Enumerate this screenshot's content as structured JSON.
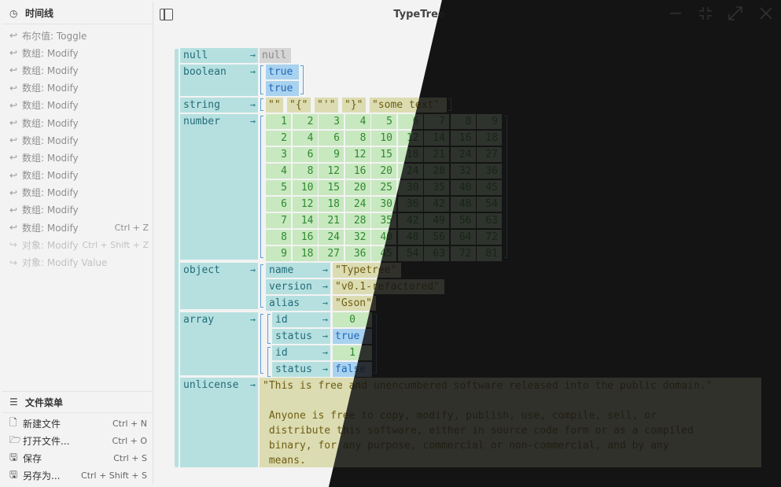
{
  "app": {
    "title": "TypeTree"
  },
  "history": {
    "header": "时间线",
    "items": [
      {
        "label": "布尔值: Toggle",
        "shortcut": "",
        "undone": false
      },
      {
        "label": "数组: Modify",
        "shortcut": "",
        "undone": false
      },
      {
        "label": "数组: Modify",
        "shortcut": "",
        "undone": false
      },
      {
        "label": "数组: Modify",
        "shortcut": "",
        "undone": false
      },
      {
        "label": "数组: Modify",
        "shortcut": "",
        "undone": false
      },
      {
        "label": "数组: Modify",
        "shortcut": "",
        "undone": false
      },
      {
        "label": "数组: Modify",
        "shortcut": "",
        "undone": false
      },
      {
        "label": "数组: Modify",
        "shortcut": "",
        "undone": false
      },
      {
        "label": "数组: Modify",
        "shortcut": "",
        "undone": false
      },
      {
        "label": "数组: Modify",
        "shortcut": "",
        "undone": false
      },
      {
        "label": "数组: Modify",
        "shortcut": "",
        "undone": false
      },
      {
        "label": "数组: Modify",
        "shortcut": "Ctrl + Z",
        "undone": false
      },
      {
        "label": "对象: Modify",
        "shortcut": "Ctrl + Shift + Z",
        "undone": true
      },
      {
        "label": "对象: Modify Value",
        "shortcut": "",
        "undone": true
      }
    ]
  },
  "file_menu": {
    "header": "文件菜单",
    "items": [
      {
        "icon": "new-file-icon",
        "label": "新建文件",
        "shortcut": "Ctrl + N"
      },
      {
        "icon": "open-folder-icon",
        "label": "打开文件...",
        "shortcut": "Ctrl + O"
      },
      {
        "icon": "save-icon",
        "label": "保存",
        "shortcut": "Ctrl + S"
      },
      {
        "icon": "save-as-icon",
        "label": "另存为...",
        "shortcut": "Ctrl + Shift + S"
      }
    ]
  },
  "tree": {
    "arrow": "→",
    "null": {
      "key": "null",
      "value": "null"
    },
    "boolean": {
      "key": "boolean",
      "values": [
        "true",
        "true"
      ]
    },
    "string": {
      "key": "string",
      "values": [
        "\"\"",
        "\"{\"",
        "\"'\"",
        "\"}\"",
        "\"some text\""
      ]
    },
    "number": {
      "key": "number",
      "matrix": [
        [
          1,
          2,
          3,
          4,
          5,
          6,
          7,
          8,
          9
        ],
        [
          2,
          4,
          6,
          8,
          10,
          12,
          14,
          16,
          18
        ],
        [
          3,
          6,
          9,
          12,
          15,
          18,
          21,
          24,
          27
        ],
        [
          4,
          8,
          12,
          16,
          20,
          24,
          28,
          32,
          36
        ],
        [
          5,
          10,
          15,
          20,
          25,
          30,
          35,
          40,
          45
        ],
        [
          6,
          12,
          18,
          24,
          30,
          36,
          42,
          48,
          54
        ],
        [
          7,
          14,
          21,
          28,
          35,
          42,
          49,
          56,
          63
        ],
        [
          8,
          16,
          24,
          32,
          40,
          48,
          56,
          64,
          72
        ],
        [
          9,
          18,
          27,
          36,
          45,
          54,
          63,
          72,
          81
        ]
      ]
    },
    "object": {
      "key": "object",
      "entries": [
        {
          "key": "name",
          "value": "\"Typetree\""
        },
        {
          "key": "version",
          "value": "\"v0.1-refactored\""
        },
        {
          "key": "alias",
          "value": "\"Gson\""
        }
      ]
    },
    "array": {
      "key": "array",
      "items": [
        {
          "id_key": "id",
          "id": "0",
          "status_key": "status",
          "status": "true"
        },
        {
          "id_key": "id",
          "id": "1",
          "status_key": "status",
          "status": "false"
        }
      ]
    },
    "unlicense": {
      "key": "unlicense",
      "value": "\"This is free and unencumbered software released into the public domain.\"\n\n Anyone is free to copy, modify, publish, use, compile, sell, or\n distribute this software, either in source code form or as a compiled\n binary, for any purpose, commercial or non-commercial, and by any\n means."
    }
  },
  "colors": {
    "light_bg": "#f3f3f3",
    "dark_bg": "#1e1e1e",
    "key_bg": "#b6e0e0",
    "string_bg": "#dcdcb2",
    "bool_bg": "#a8d2ef",
    "number_bg": "#c8e8c0"
  }
}
